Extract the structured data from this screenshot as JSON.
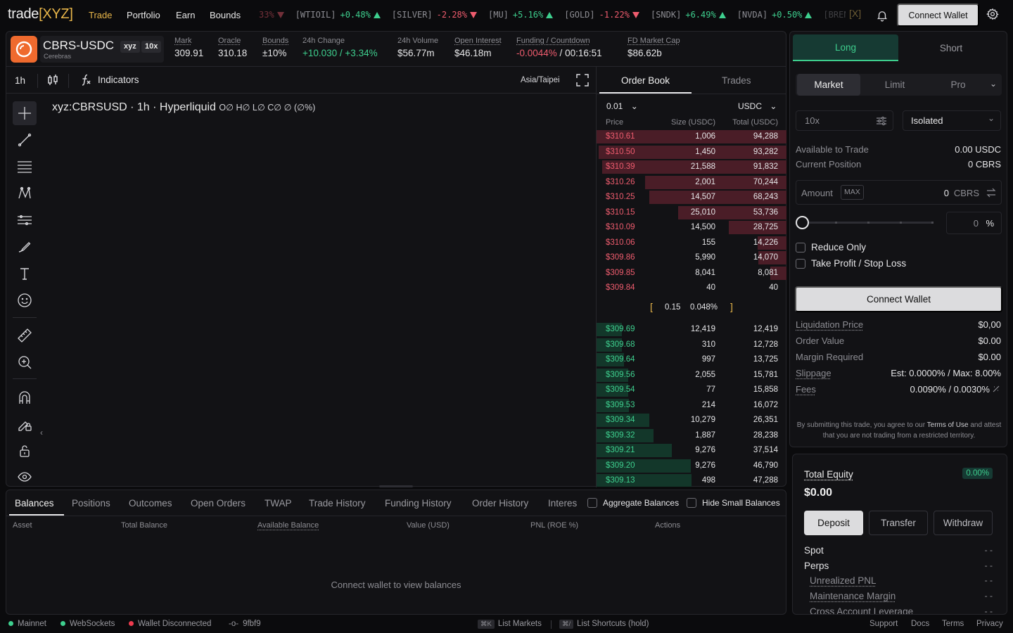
{
  "nav": {
    "logo_main": "trade",
    "logo_bracket": "[XYZ]",
    "links": [
      "Trade",
      "Portfolio",
      "Earn",
      "Bounds"
    ],
    "connect_label": "Connect Wallet"
  },
  "ticker": [
    {
      "sym": "",
      "chg": "33%",
      "dir": "dn"
    },
    {
      "sym": "[WTIOIL]",
      "chg": "+0.48%",
      "dir": "up"
    },
    {
      "sym": "[SILVER]",
      "chg": "-2.28%",
      "dir": "dn"
    },
    {
      "sym": "[MU]",
      "chg": "+5.16%",
      "dir": "up"
    },
    {
      "sym": "[GOLD]",
      "chg": "-1.22%",
      "dir": "dn"
    },
    {
      "sym": "[SNDK]",
      "chg": "+6.49%",
      "dir": "up"
    },
    {
      "sym": "[NVDA]",
      "chg": "+0.50%",
      "dir": "up"
    },
    {
      "sym": "[BREN",
      "chg": "",
      "dir": ""
    }
  ],
  "market": {
    "pair": "CBRS-USDC",
    "subname": "Cerebras",
    "badge1": "xyz",
    "badge2": "10x",
    "stats": {
      "mark_label": "Mark",
      "mark": "309.91",
      "oracle_label": "Oracle",
      "oracle": "310.18",
      "bounds_label": "Bounds",
      "bounds": "±10%",
      "change_label": "24h Change",
      "change": "+10.030 / +3.34%",
      "volume_label": "24h Volume",
      "volume": "$56.77m",
      "oi_label": "Open Interest",
      "oi": "$46.18m",
      "funding_label": "Funding / Countdown",
      "funding_rate": "-0.0044%",
      "funding_sep": " / ",
      "countdown": "00:16:51",
      "fdmc_label": "FD Market Cap",
      "fdmc": "$86.62b"
    }
  },
  "chart": {
    "interval": "1h",
    "indicators_label": "Indicators",
    "timezone": "Asia/Taipei",
    "title": "xyz:CBRSUSD · 1h · Hyperliquid",
    "ohlc": "O∅ H∅ L∅ C∅ ∅ (∅%)"
  },
  "orderbook": {
    "tab_book": "Order Book",
    "tab_trades": "Trades",
    "tick": "0.01",
    "unit": "USDC",
    "col_price": "Price",
    "col_size": "Size (USDC)",
    "col_total": "Total (USDC)",
    "spread_value": "0.15",
    "spread_pct": "0.048%",
    "asks": [
      {
        "price": "$310.61",
        "size": "1,006",
        "total": "94,288",
        "depth": 1.0
      },
      {
        "price": "$310.50",
        "size": "1,450",
        "total": "93,282",
        "depth": 0.99
      },
      {
        "price": "$310.39",
        "size": "21,588",
        "total": "91,832",
        "depth": 0.97
      },
      {
        "price": "$310.26",
        "size": "2,001",
        "total": "70,244",
        "depth": 0.745
      },
      {
        "price": "$310.25",
        "size": "14,507",
        "total": "68,243",
        "depth": 0.724
      },
      {
        "price": "$310.15",
        "size": "25,010",
        "total": "53,736",
        "depth": 0.57
      },
      {
        "price": "$310.09",
        "size": "14,500",
        "total": "28,725",
        "depth": 0.305
      },
      {
        "price": "$310.06",
        "size": "155",
        "total": "14,226",
        "depth": 0.151
      },
      {
        "price": "$309.86",
        "size": "5,990",
        "total": "14,070",
        "depth": 0.149
      },
      {
        "price": "$309.85",
        "size": "8,041",
        "total": "8,081",
        "depth": 0.086
      },
      {
        "price": "$309.84",
        "size": "40",
        "total": "40",
        "depth": 0.0
      }
    ],
    "bids": [
      {
        "price": "$309.69",
        "size": "12,419",
        "total": "12,419",
        "depth": 0.132
      },
      {
        "price": "$309.68",
        "size": "310",
        "total": "12,728",
        "depth": 0.135
      },
      {
        "price": "$309.64",
        "size": "997",
        "total": "13,725",
        "depth": 0.146
      },
      {
        "price": "$309.56",
        "size": "2,055",
        "total": "15,781",
        "depth": 0.167
      },
      {
        "price": "$309.54",
        "size": "77",
        "total": "15,858",
        "depth": 0.168
      },
      {
        "price": "$309.53",
        "size": "214",
        "total": "16,072",
        "depth": 0.17
      },
      {
        "price": "$309.34",
        "size": "10,279",
        "total": "26,351",
        "depth": 0.279
      },
      {
        "price": "$309.32",
        "size": "1,887",
        "total": "28,238",
        "depth": 0.299
      },
      {
        "price": "$309.21",
        "size": "9,276",
        "total": "37,514",
        "depth": 0.398
      },
      {
        "price": "$309.20",
        "size": "9,276",
        "total": "46,790",
        "depth": 0.496
      },
      {
        "price": "$309.13",
        "size": "498",
        "total": "47,288",
        "depth": 0.501
      }
    ]
  },
  "bottom": {
    "tabs": [
      "Balances",
      "Positions",
      "Outcomes",
      "Open Orders",
      "TWAP",
      "Trade History",
      "Funding History",
      "Order History",
      "Interes"
    ],
    "aggregate_label": "Aggregate Balances",
    "hide_small_label": "Hide Small Balances",
    "columns": [
      "Asset",
      "Total Balance",
      "Available Balance",
      "Value (USD)",
      "PNL (ROE %)",
      "Actions"
    ],
    "empty": "Connect wallet to view balances"
  },
  "trade": {
    "long": "Long",
    "short": "Short",
    "order_types": [
      "Market",
      "Limit",
      "Pro"
    ],
    "leverage": "10x",
    "margin_mode": "Isolated",
    "available_label": "Available to Trade",
    "available": "0.00 USDC",
    "position_label": "Current Position",
    "position": "0 CBRS",
    "amount_label": "Amount",
    "max_label": "MAX",
    "amount_value": "0",
    "amount_unit": "CBRS",
    "slider_value": 0,
    "slider_pct": "0",
    "pct_sign": "%",
    "reduce_only": "Reduce Only",
    "tpsl": "Take Profit / Stop Loss",
    "connect_label": "Connect Wallet",
    "liq_label": "Liquidation Price",
    "liq": "$0,00",
    "order_value_label": "Order Value",
    "order_value": "$0.00",
    "margin_label": "Margin Required",
    "margin": "$0.00",
    "slippage_label": "Slippage",
    "slippage": "Est: 0.0000% / Max: 8.00%",
    "fees_label": "Fees",
    "fees": "0.0090% / 0.0030%",
    "legal_1": "By submitting this trade, you agree to our ",
    "legal_link": "Terms of Use",
    "legal_2": " and attest that you are not trading from a restricted territory."
  },
  "equity": {
    "title": "Total Equity",
    "badge": "0.00%",
    "value": "$0.00",
    "deposit": "Deposit",
    "transfer": "Transfer",
    "withdraw": "Withdraw",
    "rows": [
      {
        "label": "Spot",
        "value": "- -"
      },
      {
        "label": "Perps",
        "value": "- -"
      },
      {
        "label": "Unrealized PNL",
        "value": "- -"
      },
      {
        "label": "Maintenance Margin",
        "value": "- -"
      },
      {
        "label": "Cross Account Leverage",
        "value": "- -"
      }
    ]
  },
  "footer": {
    "mainnet": "Mainnet",
    "websockets": "WebSockets",
    "wallet": "Wallet Disconnected",
    "commit": "9fbf9",
    "kbd1": "⌘K",
    "list_markets": "List Markets",
    "kbd2": "⌘/",
    "shortcuts": "List Shortcuts (hold)",
    "links": [
      "Support",
      "Docs",
      "Terms",
      "Privacy"
    ]
  },
  "colors": {
    "accent": "#e8b64a",
    "up": "#3ecf8e",
    "down": "#ef5c6e",
    "coin": "#ef6a2e"
  }
}
